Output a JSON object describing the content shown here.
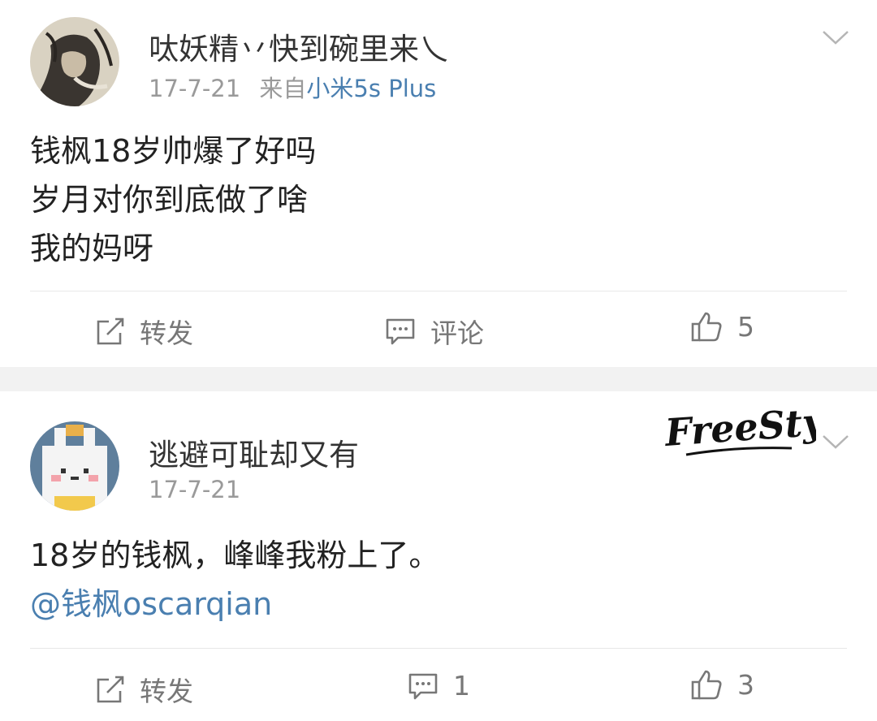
{
  "posts": [
    {
      "username": "呔妖精丷快到碗里来乀",
      "date": "17-7-21",
      "source_prefix": "来自",
      "source": "小米5s Plus",
      "lines": [
        "钱枫18岁帅爆了好吗",
        "岁月对你到底做了啥",
        "我的妈呀"
      ],
      "actions": {
        "repost": "转发",
        "comment": "评论",
        "like": "5"
      }
    },
    {
      "username": "逃避可耻却又有",
      "date": "17-7-21",
      "lines": [
        "18岁的钱枫，峰峰我粉上了。"
      ],
      "mention": "@钱枫oscarqian",
      "actions": {
        "repost": "转发",
        "comment": "1",
        "like": "3"
      }
    }
  ],
  "watermark": "FreeStyle",
  "icons": [
    "avatar-ink-painting",
    "avatar-pixel-bunny",
    "chevron-down-icon",
    "repost-icon",
    "comment-icon",
    "thumbs-up-icon"
  ],
  "colors": {
    "text": "#222222",
    "meta": "#9a9a9a",
    "link": "#4a7fb0",
    "action": "#777777",
    "separator": "#f2f2f2"
  }
}
